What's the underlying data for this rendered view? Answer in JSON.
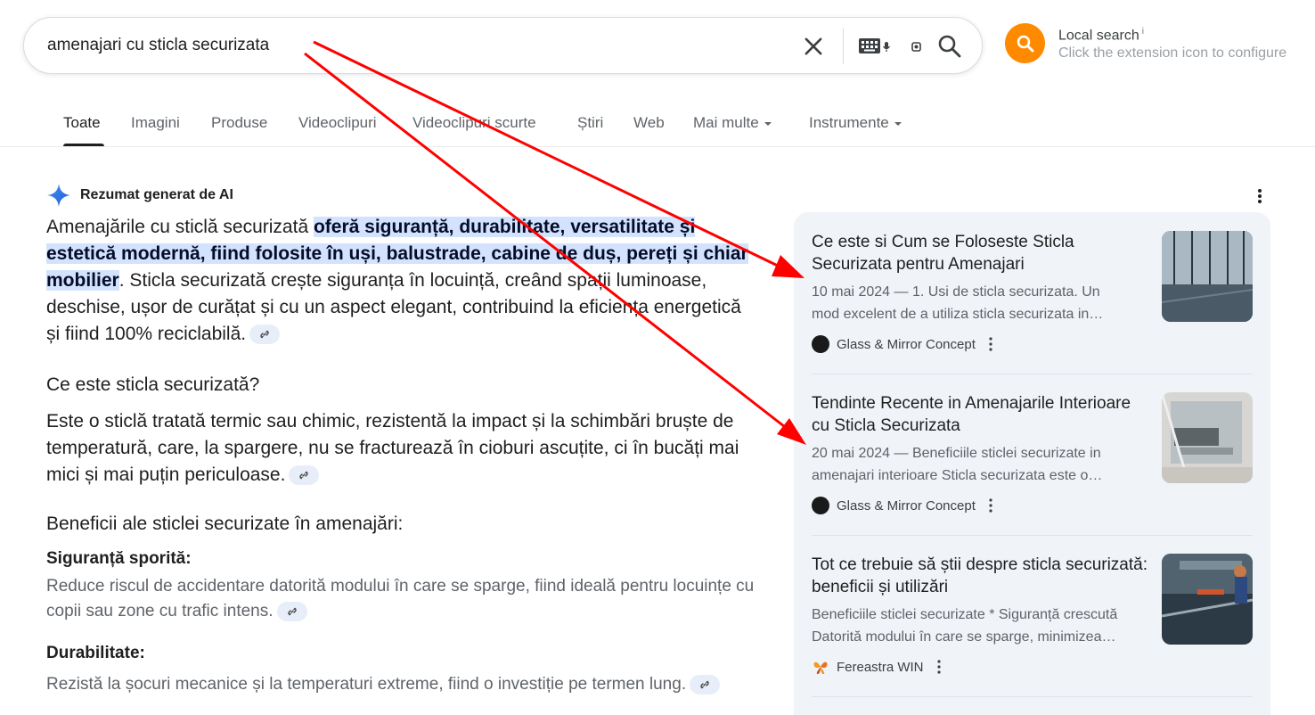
{
  "search": {
    "query": "amenajari cu sticla securizata"
  },
  "extension": {
    "title": "Local search",
    "info": "i",
    "subtitle": "Click the extension icon to configure",
    "accent": "#ff8a00"
  },
  "tabs": [
    {
      "label": "Toate"
    },
    {
      "label": "Imagini"
    },
    {
      "label": "Produse"
    },
    {
      "label": "Videoclipuri"
    },
    {
      "label": "Videoclipuri scurte"
    },
    {
      "label": "Știri"
    },
    {
      "label": "Web"
    },
    {
      "label": "Mai multe"
    },
    {
      "label": "Instrumente"
    }
  ],
  "ai": {
    "title": "Rezumat generat de AI",
    "intro_pre": "Amenajările cu sticlă securizată ",
    "intro_highlight": "oferă siguranță, durabilitate, versatilitate și estetică modernă, fiind folosite în uși, balustrade, cabine de duș, pereți și chiar mobilier",
    "intro_post": ". Sticla securizată crește siguranța în locuință, creând spații luminoase, deschise, ușor de curățat și cu un aspect elegant, contribuind la eficiența energetică și fiind 100% reciclabilă.",
    "h_what": "Ce este sticla securizată?",
    "what_text": "Este o sticlă tratată termic sau chimic, rezistentă la impact și la schimbări bruște de temperatură, care, la spargere, nu se fracturează în cioburi ascuțite, ci în bucăți mai mici și mai puțin periculoase.",
    "h_benefits": "Beneficii ale sticlei securizate în amenajări:",
    "benefits": [
      {
        "title": "Siguranță sporită:",
        "text": "Reduce riscul de accidentare datorită modului în care se sparge, fiind ideală pentru locuințe cu copii sau zone cu trafic intens."
      },
      {
        "title": "Durabilitate:",
        "text": "Rezistă la șocuri mecanice și la temperaturi extreme, fiind o investiție pe termen lung."
      }
    ],
    "highlight_color": "#d3e3fd"
  },
  "sources": [
    {
      "title": "Ce este si Cum se Foloseste Sticla Securizata pentru Amenajari",
      "snippet_1": "10 mai 2024 — 1. Usi de sticla securizata. Un",
      "snippet_2": "mod excelent de a utiliza sticla securizata in…",
      "site": "Glass & Mirror Concept"
    },
    {
      "title": "Tendinte Recente in Amenajarile Interioare cu Sticla Securizata",
      "snippet_1": "20 mai 2024 — Beneficiile sticlei securizate in",
      "snippet_2": "amenajari interioare Sticla securizata este o…",
      "site": "Glass & Mirror Concept"
    },
    {
      "title": "Tot ce trebuie să știi despre sticla securizată: beneficii și utilizări",
      "snippet_1": "Beneficiile sticlei securizate * Siguranță crescută",
      "snippet_2": "Datorită modului în care se sparge, minimizea…",
      "site": "Fereastra WIN"
    }
  ],
  "annotation_color": "#ff0000"
}
